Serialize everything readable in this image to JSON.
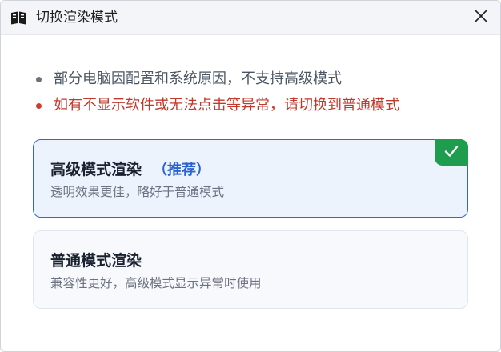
{
  "window": {
    "title": "切换渲染模式",
    "app_icon": "book-icon",
    "close_icon": "close-icon"
  },
  "notes": [
    {
      "text": "部分电脑因配置和系统原因，不支持高级模式",
      "color": "#4b5563",
      "dot_color": "#6b7280"
    },
    {
      "text": "如有不显示软件或无法点击等异常，请切换到普通模式",
      "color": "#c0392b",
      "dot_color": "#d23a2f"
    }
  ],
  "options": [
    {
      "title": "高级模式渲染",
      "tag": "（推荐）",
      "description": "透明效果更佳，略好于普通模式",
      "selected": true,
      "badge_icon": "checkmark-icon"
    },
    {
      "title": "普通模式渲染",
      "description": "兼容性更好，高级模式显示异常时使用",
      "selected": false
    }
  ],
  "colors": {
    "accent": "#2a62d1",
    "selected_border": "#3068c9",
    "check_badge": "#1f9d4f",
    "warning": "#c0392b"
  }
}
